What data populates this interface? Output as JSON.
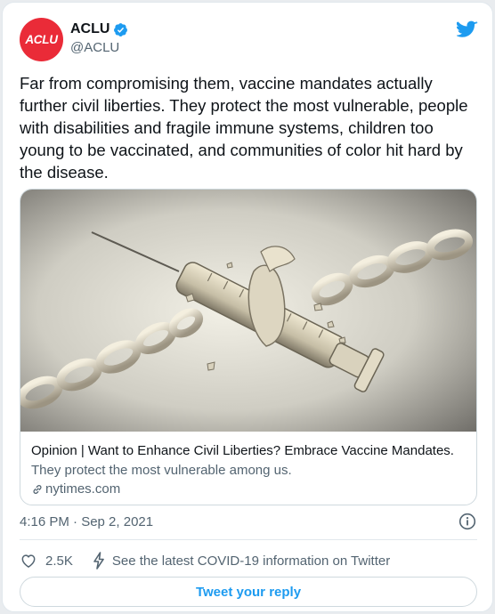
{
  "author": {
    "avatar_text": "ACLU",
    "display_name": "ACLU",
    "handle": "@ACLU",
    "avatar_color": "#ea2b38",
    "verified_icon": "verified-badge-icon"
  },
  "tweet": {
    "text": "Far from compromising them, vaccine mandates actually further civil liberties. They protect the most vulnerable, people with disabilities and fragile immune systems, children too young to be vaccinated, and communities of color hit hard by the disease."
  },
  "link_card": {
    "image_icon": "syringe-breaking-chain-illustration",
    "title": "Opinion | Want to Enhance Civil Liberties? Embrace Vaccine Mandates.",
    "description": "They protect the most vulnerable among us.",
    "domain": "nytimes.com"
  },
  "meta": {
    "timestamp": "4:16 PM · Sep 2, 2021"
  },
  "actions": {
    "like_count": "2.5K",
    "covid_notice": "See the latest COVID-19 information on Twitter"
  },
  "reply_button": {
    "label": "Tweet your reply"
  },
  "colors": {
    "accent": "#1d9bf0",
    "text_primary": "#0f1419",
    "text_secondary": "#536471",
    "border": "#cfd9de"
  }
}
